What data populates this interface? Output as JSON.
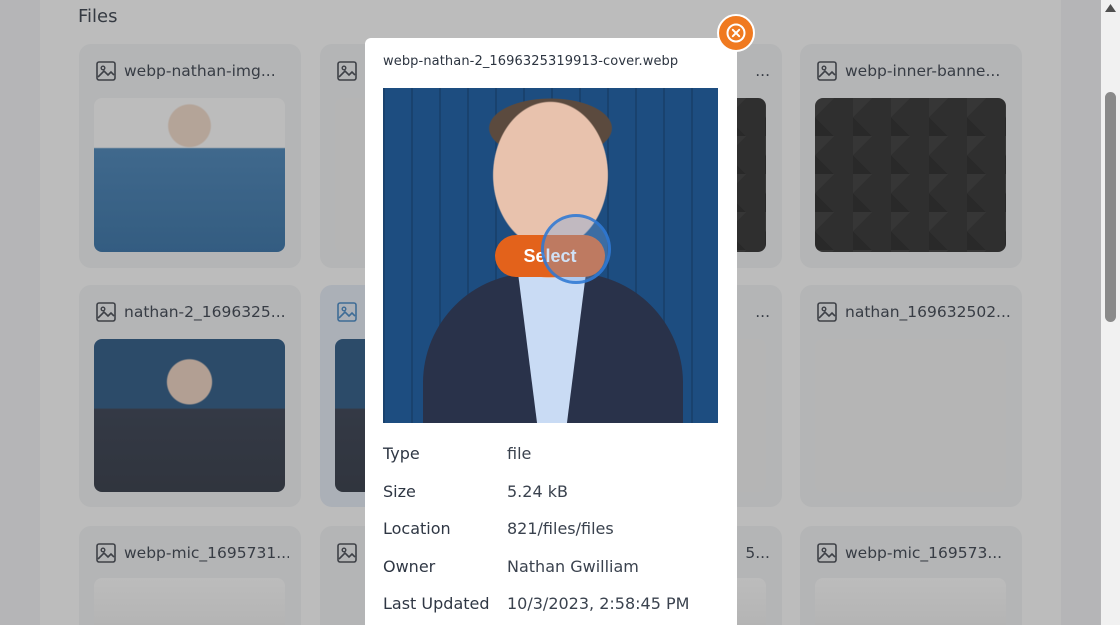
{
  "page": {
    "section_title": "Files"
  },
  "cards": [
    {
      "title": "webp-nathan-img..."
    },
    {
      "title": ""
    },
    {
      "title": "..."
    },
    {
      "title": "webp-inner-banne..."
    },
    {
      "title": "nathan-2_1696325..."
    },
    {
      "title": ""
    },
    {
      "title": "..."
    },
    {
      "title": "nathan_169632502..."
    },
    {
      "title": "webp-mic_1695731..."
    },
    {
      "title": ""
    },
    {
      "title": "5..."
    },
    {
      "title": "webp-mic_169573..."
    }
  ],
  "modal": {
    "title": "webp-nathan-2_1696325319913-cover.webp",
    "select_label": "Select",
    "close_icon": "close-circle-icon",
    "details": [
      {
        "label": "Type",
        "value": "file"
      },
      {
        "label": "Size",
        "value": "5.24 kB"
      },
      {
        "label": "Location",
        "value": "821/files/files"
      },
      {
        "label": "Owner",
        "value": "Nathan Gwilliam"
      },
      {
        "label": "Last Updated",
        "value": "10/3/2023, 2:58:45 PM"
      }
    ]
  },
  "colors": {
    "accent": "#e3621b",
    "close": "#f07a20"
  }
}
